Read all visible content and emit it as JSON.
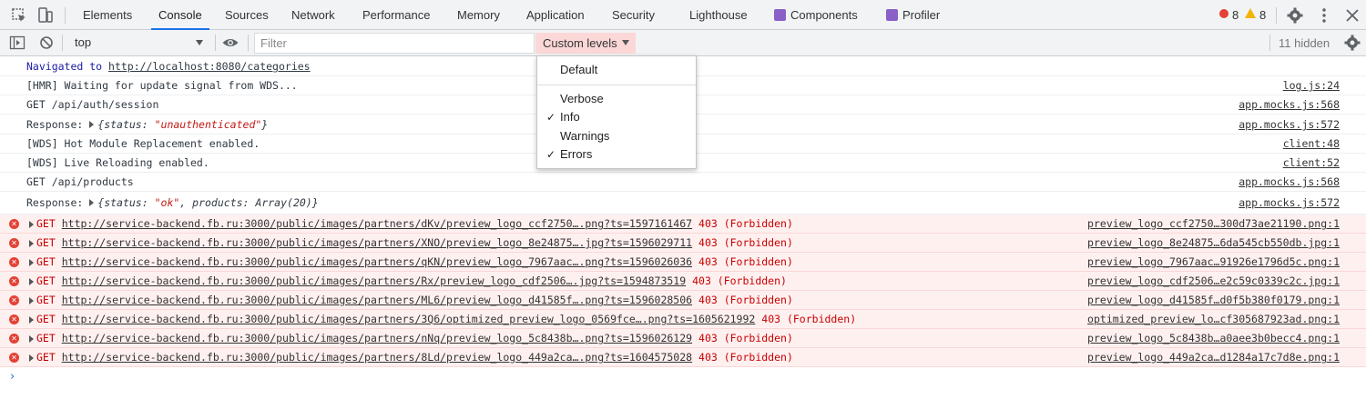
{
  "tabs": [
    {
      "label": "Elements",
      "active": false
    },
    {
      "label": "Console",
      "active": true
    },
    {
      "label": "Sources",
      "active": false
    },
    {
      "label": "Network",
      "active": false
    },
    {
      "label": "Performance",
      "active": false
    },
    {
      "label": "Memory",
      "active": false
    },
    {
      "label": "Application",
      "active": false
    },
    {
      "label": "Security",
      "active": false
    },
    {
      "label": "Lighthouse",
      "active": false
    },
    {
      "label": "Components",
      "active": false
    },
    {
      "label": "Profiler",
      "active": false
    }
  ],
  "counts": {
    "errors": "8",
    "warnings": "8"
  },
  "toolbar": {
    "context": "top",
    "filter_placeholder": "Filter",
    "levels_label": "Custom levels",
    "hidden_count": "11 hidden"
  },
  "levels_menu": {
    "default_label": "Default",
    "items": [
      {
        "label": "Verbose",
        "checked": false
      },
      {
        "label": "Info",
        "checked": true
      },
      {
        "label": "Warnings",
        "checked": false
      },
      {
        "label": "Errors",
        "checked": true
      }
    ],
    "check_mark": "✓"
  },
  "messages": {
    "navigated_prefix": "Navigated to",
    "navigated_url": "http://localhost:8080/categories",
    "hmr": "[HMR] Waiting for update signal from WDS...",
    "hmr_src": "log.js:24",
    "get_session": "GET /api/auth/session",
    "get_session_src": "app.mocks.js:568",
    "response1_label": "Response:",
    "response1_key": "status",
    "response1_val": "\"unauthenticated\"",
    "response1_src": "app.mocks.js:572",
    "wds_hot": "[WDS] Hot Module Replacement enabled.",
    "wds_hot_src": "client:48",
    "wds_live": "[WDS] Live Reloading enabled.",
    "wds_live_src": "client:52",
    "get_products": "GET /api/products",
    "get_products_src": "app.mocks.js:568",
    "response2_label": "Response:",
    "response2_key1": "status",
    "response2_val1": "\"ok\"",
    "response2_key2": "products",
    "response2_val2": "Array(20)",
    "response2_src": "app.mocks.js:572"
  },
  "errors": [
    {
      "method": "GET",
      "url": "http://service-backend.fb.ru:3000/public/images/partners/dKv/preview_logo_ccf2750….png?ts=1597161467",
      "status": "403 (Forbidden)",
      "src": "preview_logo_ccf2750…300d73ae21190.png:1"
    },
    {
      "method": "GET",
      "url": "http://service-backend.fb.ru:3000/public/images/partners/XNO/preview_logo_8e24875….jpg?ts=1596029711",
      "status": "403 (Forbidden)",
      "src": "preview_logo_8e24875…6da545cb550db.jpg:1"
    },
    {
      "method": "GET",
      "url": "http://service-backend.fb.ru:3000/public/images/partners/qKN/preview_logo_7967aac….png?ts=1596026036",
      "status": "403 (Forbidden)",
      "src": "preview_logo_7967aac…91926e1796d5c.png:1"
    },
    {
      "method": "GET",
      "url": "http://service-backend.fb.ru:3000/public/images/partners/Rx/preview_logo_cdf2506….jpg?ts=1594873519",
      "status": "403 (Forbidden)",
      "src": "preview_logo_cdf2506…e2c59c0339c2c.jpg:1"
    },
    {
      "method": "GET",
      "url": "http://service-backend.fb.ru:3000/public/images/partners/ML6/preview_logo_d41585f….png?ts=1596028506",
      "status": "403 (Forbidden)",
      "src": "preview_logo_d41585f…d0f5b380f0179.png:1"
    },
    {
      "method": "GET",
      "url": "http://service-backend.fb.ru:3000/public/images/partners/3Q6/optimized_preview_logo_0569fce….png?ts=1605621992",
      "status": "403 (Forbidden)",
      "src": "optimized_preview_lo…cf305687923ad.png:1"
    },
    {
      "method": "GET",
      "url": "http://service-backend.fb.ru:3000/public/images/partners/nNq/preview_logo_5c8438b….png?ts=1596026129",
      "status": "403 (Forbidden)",
      "src": "preview_logo_5c8438b…a0aee3b0becc4.png:1"
    },
    {
      "method": "GET",
      "url": "http://service-backend.fb.ru:3000/public/images/partners/8Ld/preview_logo_449a2ca….png?ts=1604575028",
      "status": "403 (Forbidden)",
      "src": "preview_logo_449a2ca…d1284a17c7d8e.png:1"
    }
  ],
  "prompt_glyph": "›",
  "colors": {
    "accent": "#1a73e8",
    "error": "#e34234",
    "warning": "#f4b400",
    "error_bg": "#fff0f0"
  }
}
